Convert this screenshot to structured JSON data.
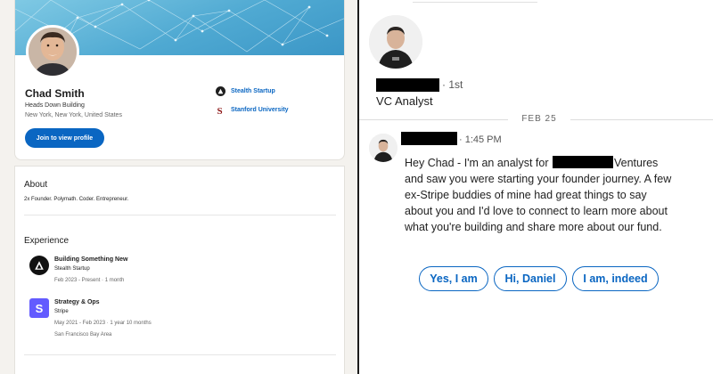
{
  "profile": {
    "name": "Chad Smith",
    "headline": "Heads Down Building",
    "location": "New York, New York, United States",
    "view_button": "Join to view profile",
    "links": [
      {
        "label": "Stealth Startup",
        "icon": "stealth-logo-icon"
      },
      {
        "label": "Stanford University",
        "icon": "stanford-logo-icon"
      }
    ],
    "banner_color": "#4fa9d2",
    "accent": "#0a66c2"
  },
  "about": {
    "title": "About",
    "text": "2x Founder. Polymath. Coder. Entrepreneur."
  },
  "experience": {
    "title": "Experience",
    "items": [
      {
        "role": "Building Something New",
        "company": "Stealth Startup",
        "dates": "Feb 2023 - Present · 1 month",
        "logo": "stealth-logo-icon"
      },
      {
        "role": "Strategy & Ops",
        "company": "Stripe",
        "dates": "May 2021 - Feb 2023 · 1 year 10 months",
        "location": "San Francisco Bay Area",
        "logo": "stripe-logo-icon",
        "logo_letter": "S",
        "logo_color": "#635bff"
      }
    ]
  },
  "conversation": {
    "degree": "· 1st",
    "sender_title": "VC Analyst",
    "date_divider": "FEB 25",
    "message_time": "· 1:45 PM",
    "message": {
      "line1_before": "Hey Chad - I'm an analyst for ",
      "line1_after": "Ventures",
      "line2": "and saw you were starting your founder journey. A few",
      "line3": "ex-Stripe buddies of mine had great things to say",
      "line4": "about you and I'd love to connect to learn more about",
      "line5": "what you're building and share more about our fund."
    },
    "quick_replies": [
      "Yes, I am",
      "Hi, Daniel",
      "I am, indeed"
    ]
  }
}
